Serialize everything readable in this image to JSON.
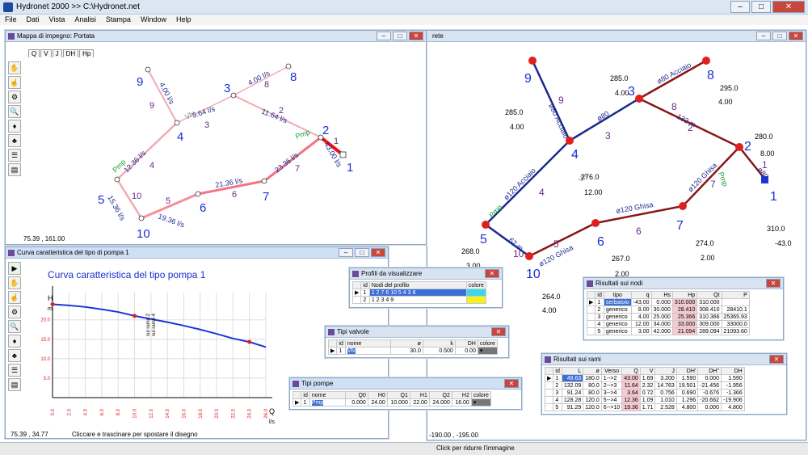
{
  "app": {
    "title": "Hydronet 2000 >> C:\\Hydronet.net"
  },
  "menu": [
    "File",
    "Dati",
    "Vista",
    "Analisi",
    "Stampa",
    "Window",
    "Help"
  ],
  "map_window": {
    "title": "Mappa di impegno: Portata",
    "tabs": [
      "Q",
      "V",
      "J",
      "DH",
      "Hp"
    ],
    "status_left": "75.39 , 161.00"
  },
  "network_window": {
    "title_fragment": "rete",
    "status_left": "-190.00 , -195.00",
    "status_right": "Click per ridurre l'immagine"
  },
  "pump_curve_window": {
    "title": "Curva caratteristica del tipo di pompa 1",
    "chart_title": "Curva caratteristica del tipo pompa 1",
    "status_left": "75.39 , 34.77",
    "status_right": "Cliccare e trascinare per spostare il disegno"
  },
  "chart_data": {
    "type": "line",
    "title": "Curva caratteristica del tipo pompa 1",
    "xlabel": "Q l/s",
    "ylabel": "H m",
    "x": [
      0,
      2,
      4,
      6,
      8,
      10,
      12,
      14,
      16,
      18,
      20,
      22,
      24,
      26
    ],
    "y": [
      24.0,
      23.7,
      23.3,
      22.7,
      22.0,
      21.0,
      20.2,
      19.4,
      18.5,
      17.5,
      16.4,
      15.2,
      14.3,
      13.0
    ],
    "markers": [
      {
        "x": 0,
        "y": 24.0
      },
      {
        "x": 10,
        "y": 21.0
      },
      {
        "x": 24,
        "y": 14.3
      }
    ],
    "annotations": [
      "sul ramo 2",
      "sul ramo 4"
    ],
    "x_ticks": [
      "0.0",
      "2.0",
      "4.0",
      "6.0",
      "8.0",
      "10.0",
      "12.0",
      "14.0",
      "16.0",
      "18.0",
      "20.0",
      "22.0",
      "24.0",
      "26.0"
    ],
    "y_ticks": [
      "20.0",
      "15.0",
      "10.0",
      "5.0"
    ],
    "xlim": [
      0,
      26
    ],
    "ylim": [
      0,
      27
    ]
  },
  "profili": {
    "title": "Profili da visualizzare",
    "headers": [
      "id",
      "Nodi del profilo",
      "colore"
    ],
    "rows": [
      [
        "1",
        "1 2 7 6 10 5 4 3 8",
        ""
      ],
      [
        "2",
        "1 2 3 4 9",
        ""
      ]
    ]
  },
  "valvole": {
    "title": "Tipi valvole",
    "headers": [
      "id",
      "nome",
      "ø",
      "k",
      "DH",
      "colore"
    ],
    "rows": [
      [
        "1",
        "Vlv",
        "30.0",
        "0.500",
        "0.00",
        ""
      ]
    ]
  },
  "pompe": {
    "title": "Tipi pompe",
    "headers": [
      "id",
      "nome",
      "Q0",
      "H0",
      "Q1",
      "H1",
      "Q2",
      "H2",
      "colore"
    ],
    "rows": [
      [
        "1",
        "Pmp",
        "0.000",
        "24.00",
        "10.000",
        "22.00",
        "24.000",
        "16.00",
        ""
      ]
    ]
  },
  "nodi": {
    "title": "Risultati sui nodi",
    "headers": [
      "id",
      "tipo",
      "q",
      "Hs",
      "Hp",
      "Qt",
      "P"
    ],
    "rows": [
      [
        "1",
        "serbatoio",
        "-43.00",
        "0.000",
        "310.000",
        "310.000",
        ""
      ],
      [
        "2",
        "generico",
        "8.00",
        "30.000",
        "28.410",
        "308.410",
        "28410.1"
      ],
      [
        "3",
        "generico",
        "4.00",
        "25.000",
        "25.366",
        "310.366",
        "25365.93"
      ],
      [
        "4",
        "generico",
        "12.00",
        "34.000",
        "33.000",
        "309.000",
        "33000.0"
      ],
      [
        "5",
        "generico",
        "3.00",
        "42.000",
        "21.094",
        "289.094",
        "21093.60"
      ]
    ]
  },
  "rami": {
    "title": "Risultati sui rami",
    "headers": [
      "id",
      "L",
      "ø",
      "Verso",
      "Q",
      "V",
      "J",
      "DH'",
      "DH''",
      "DH"
    ],
    "rows": [
      [
        "1",
        "49.63",
        "180.0",
        "1-->2",
        "43.00",
        "1.69",
        "3.200",
        "1.590",
        "0.000",
        "1.590"
      ],
      [
        "2",
        "132.09",
        "80.0",
        "2-->3",
        "11.64",
        "2.32",
        "14.763",
        "19.501",
        "-21.456",
        "-1.956"
      ],
      [
        "3",
        "91.24",
        "80.0",
        "3-->4",
        "3.64",
        "0.72",
        "0.756",
        "0.690",
        "-0.676",
        "-1.366"
      ],
      [
        "4",
        "128.28",
        "120.0",
        "5-->4",
        "12.36",
        "1.09",
        "1.010",
        "1.296",
        "-20.662",
        "-19.906"
      ],
      [
        "5",
        "91.29",
        "120.0",
        "6-->10",
        "19.36",
        "1.71",
        "2.528",
        "4.800",
        "0.000",
        "4.800"
      ]
    ]
  },
  "map_labels": {
    "nodes": [
      "1",
      "2",
      "3",
      "4",
      "5",
      "6",
      "7",
      "8",
      "9",
      "10"
    ],
    "branch_ids": [
      "1",
      "2",
      "3",
      "4",
      "5",
      "6",
      "7",
      "8",
      "9",
      "10"
    ],
    "flows": [
      "43.00 l/s",
      "11.64 l/s",
      "3.64 l/s",
      "12.36 l/s",
      "19.36 l/s",
      "21.36 l/s",
      "23.36 l/s",
      "4.00 l/s",
      "4.00 l/s",
      "15.36 l/s"
    ],
    "pump": "Pmp",
    "valve": "Vlv"
  },
  "net_labels": {
    "nodes": [
      "1",
      "2",
      "3",
      "4",
      "5",
      "6",
      "7",
      "8",
      "9",
      "10"
    ],
    "branch_ids": [
      "1",
      "2",
      "3",
      "4",
      "5",
      "6",
      "7",
      "8",
      "9",
      "10"
    ],
    "pipes": [
      "ø80 Acciaio",
      "ø80 Acciaio",
      "ø80",
      "ø120 Acciaio",
      "ø120 Ghisa",
      "ø120 Ghisa",
      "ø120 Ghisa",
      "132 m",
      "ø80",
      "62 m"
    ],
    "heads": [
      "310.0",
      "280.0",
      "285.0",
      "276.0",
      "268.0",
      "267.0",
      "274.0",
      "295.0",
      "285.0",
      "264.0"
    ],
    "demands": [
      "-43.0",
      "8.00",
      "4.00",
      "12.00",
      "3.00",
      "2.00",
      "2.00",
      "4.00",
      "4.00",
      "4.00"
    ],
    "pump": "Pmp",
    "valve": "Vlv"
  }
}
